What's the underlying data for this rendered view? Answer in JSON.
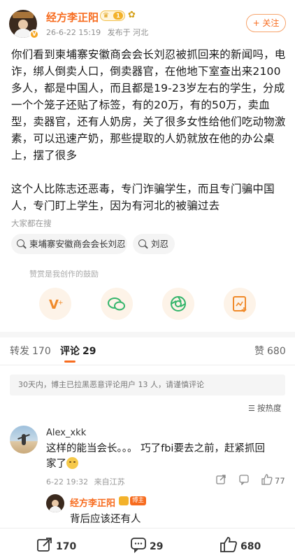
{
  "post": {
    "author": "经方李正阳",
    "level": "1",
    "date": "26-6-22 15:19",
    "location": "发布于 河北",
    "follow_label": "+ 关注",
    "paragraph1": "你们看到柬埔寨安徽商会会长刘忍被抓回来的新闻吗，电诈，绑人倒卖人口，倒卖器官，在他地下室查出来2100多人，都是中国人，而且都是19-23岁左右的学生，分成一个个笼子还贴了标签，有的20万，有的50万，卖血型，卖器官，还有人奶房，关了很多女性给他们吃动物激素，可以迅速产奶，那些提取的人奶就放在他的办公桌上，摆了很多",
    "paragraph2": "这个人比陈志还恶毒，专门诈骗学生，而且专门骗中国人，专门盯上学生，因为有河北的被骗过去"
  },
  "search": {
    "label": "大家都在搜",
    "chips": [
      "柬埔寨安徽商会会长刘忍",
      "刘忍"
    ]
  },
  "tip": {
    "label": "赞赏是我创作的鼓励",
    "icons": [
      "vip-tip-icon",
      "wechat-icon",
      "moments-icon",
      "save-image-icon"
    ]
  },
  "tabs": {
    "repost_label": "转发",
    "repost_count": "170",
    "comment_label": "评论",
    "comment_count": "29",
    "like_label": "赞",
    "like_count": "680"
  },
  "notice": "30天内，博主已拉黑恶意评论用户 13 人，请谨慎评论",
  "sort_label": "按热度",
  "comment": {
    "user": "Alex_xkk",
    "text_line1": "这样的能当会长。。。 巧了fbi要去之前，赶紧抓回",
    "text_line2": "家了",
    "time": "6-22 19:32",
    "source": "来自江苏",
    "likes": "77",
    "reply": {
      "user": "经方李正阳",
      "badge": "博主",
      "text": "背后应该还有人"
    }
  },
  "bottom_bar": {
    "repost_count": "170",
    "comment_count": "29",
    "like_count": "680"
  },
  "colors": {
    "accent": "#f76c1f",
    "muted": "#999999"
  }
}
